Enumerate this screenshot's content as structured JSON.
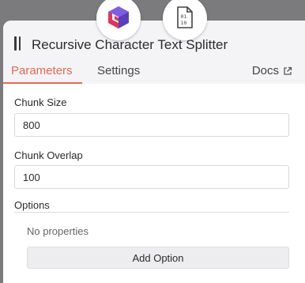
{
  "node": {
    "title": "Recursive Character Text Splitter",
    "icons": [
      "cube-logo-icon",
      "binary-file-icon"
    ]
  },
  "tabs": [
    {
      "label": "Parameters",
      "active": true
    },
    {
      "label": "Settings",
      "active": false
    }
  ],
  "docs": {
    "label": "Docs",
    "icon": "external-link-icon"
  },
  "fields": {
    "chunk_size": {
      "label": "Chunk Size",
      "value": "800"
    },
    "chunk_overlap": {
      "label": "Chunk Overlap",
      "value": "100"
    }
  },
  "options": {
    "label": "Options",
    "empty_text": "No properties",
    "add_label": "Add Option"
  },
  "colors": {
    "accent": "#e8674f",
    "logo_red": "#d9385a",
    "logo_purple": "#5a3fb8"
  }
}
